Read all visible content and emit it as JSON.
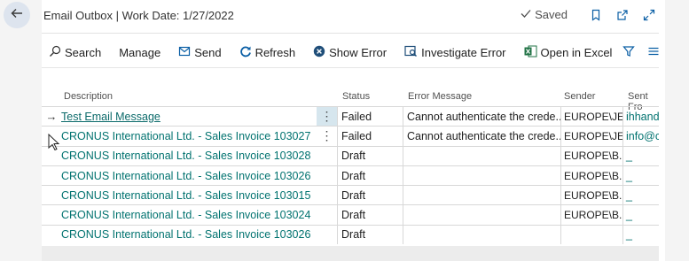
{
  "header": {
    "title": "Email Outbox | Work Date: 1/27/2022",
    "saved_label": "Saved"
  },
  "toolbar": {
    "search": "Search",
    "manage": "Manage",
    "send": "Send",
    "refresh": "Refresh",
    "show_error": "Show Error",
    "investigate_error": "Investigate Error",
    "open_in_excel": "Open in Excel"
  },
  "columns": {
    "description": "Description",
    "status": "Status",
    "error_message": "Error Message",
    "sender": "Sender",
    "sent_from": "Sent Fro"
  },
  "rows": [
    {
      "description": "Test Email Message",
      "status": "Failed",
      "error": "Cannot authenticate the crede...",
      "sender": "EUROPE\\JE...",
      "sent_from": "ihhands"
    },
    {
      "description": "CRONUS International Ltd. - Sales Invoice 103027",
      "status": "Failed",
      "error": "Cannot authenticate the crede...",
      "sender": "EUROPE\\JE...",
      "sent_from": "info@c"
    },
    {
      "description": "CRONUS International Ltd. - Sales Invoice 103028",
      "status": "Draft",
      "error": "",
      "sender": "EUROPE\\B...",
      "sent_from": "_"
    },
    {
      "description": "CRONUS International Ltd. - Sales Invoice 103026",
      "status": "Draft",
      "error": "",
      "sender": "EUROPE\\B...",
      "sent_from": "_"
    },
    {
      "description": "CRONUS International Ltd. - Sales Invoice 103015",
      "status": "Draft",
      "error": "",
      "sender": "EUROPE\\B...",
      "sent_from": "_"
    },
    {
      "description": "CRONUS International Ltd. - Sales Invoice 103024",
      "status": "Draft",
      "error": "",
      "sender": "EUROPE\\B...",
      "sent_from": "_"
    },
    {
      "description": "CRONUS International Ltd. - Sales Invoice 103026",
      "status": "Draft",
      "error": "",
      "sender": "",
      "sent_from": "_"
    }
  ],
  "icons": {
    "back": "arrow-left-icon",
    "saved": "check-icon",
    "bookmark": "bookmark-icon",
    "popout": "open-new-window-icon",
    "expand": "expand-icon",
    "search": "search-icon",
    "send": "send-icon",
    "refresh": "refresh-icon",
    "show_error": "error-x-icon",
    "investigate": "investigate-icon",
    "excel": "excel-icon",
    "filter": "filter-icon",
    "list": "list-icon",
    "row_arrow": "row-arrow-icon",
    "row_menu": "ellipsis-vertical-icon"
  },
  "colors": {
    "link": "#00726f",
    "back_button": "#dde4ee",
    "selected_cell": "#d6e6ee",
    "accent": "#0b5fa5"
  }
}
